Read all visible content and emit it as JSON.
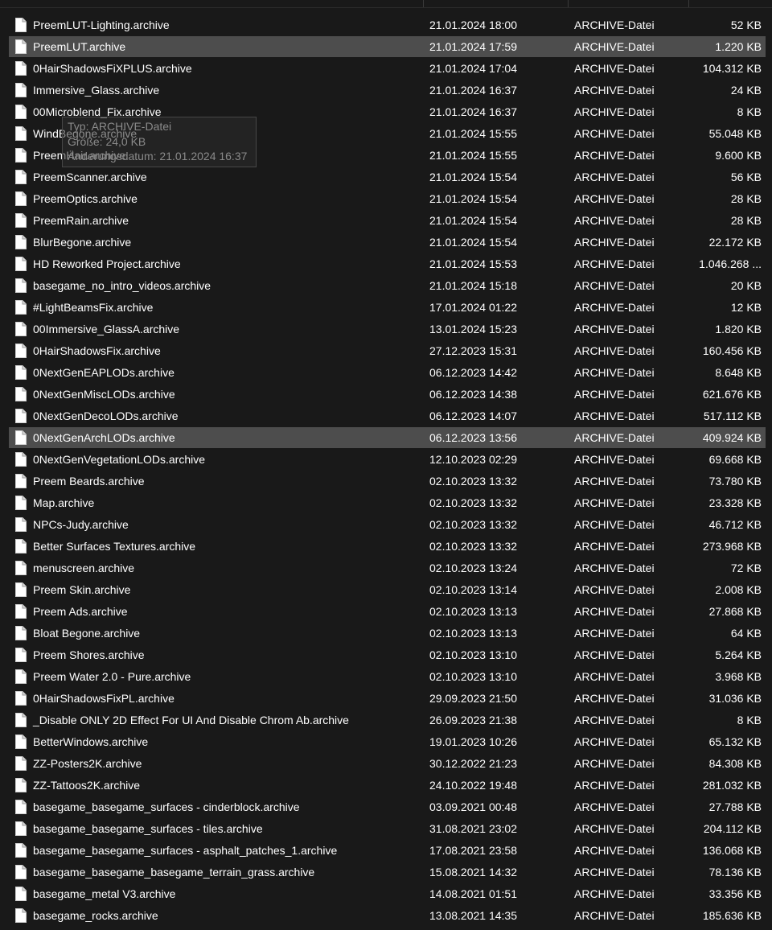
{
  "files": [
    {
      "name": "PreemLUT-Lighting.archive",
      "date": "21.01.2024 18:00",
      "type": "ARCHIVE-Datei",
      "size": "52 KB"
    },
    {
      "name": "PreemLUT.archive",
      "date": "21.01.2024 17:59",
      "type": "ARCHIVE-Datei",
      "size": "1.220 KB",
      "selected": true
    },
    {
      "name": "0HairShadowsFiXPLUS.archive",
      "date": "21.01.2024 17:04",
      "type": "ARCHIVE-Datei",
      "size": "104.312 KB"
    },
    {
      "name": "Immersive_Glass.archive",
      "date": "21.01.2024 16:37",
      "type": "ARCHIVE-Datei",
      "size": "24 KB"
    },
    {
      "name": "00Microblend_Fix.archive",
      "date": "21.01.2024 16:37",
      "type": "ARCHIVE-Datei",
      "size": "8 KB"
    },
    {
      "name": "WindBegone.archive",
      "date": "21.01.2024 15:55",
      "type": "ARCHIVE-Datei",
      "size": "55.048 KB"
    },
    {
      "name": "PreemHair.archive",
      "date": "21.01.2024 15:55",
      "type": "ARCHIVE-Datei",
      "size": "9.600 KB"
    },
    {
      "name": "PreemScanner.archive",
      "date": "21.01.2024 15:54",
      "type": "ARCHIVE-Datei",
      "size": "56 KB"
    },
    {
      "name": "PreemOptics.archive",
      "date": "21.01.2024 15:54",
      "type": "ARCHIVE-Datei",
      "size": "28 KB"
    },
    {
      "name": "PreemRain.archive",
      "date": "21.01.2024 15:54",
      "type": "ARCHIVE-Datei",
      "size": "28 KB"
    },
    {
      "name": "BlurBegone.archive",
      "date": "21.01.2024 15:54",
      "type": "ARCHIVE-Datei",
      "size": "22.172 KB"
    },
    {
      "name": "HD Reworked Project.archive",
      "date": "21.01.2024 15:53",
      "type": "ARCHIVE-Datei",
      "size": "1.046.268 ..."
    },
    {
      "name": "basegame_no_intro_videos.archive",
      "date": "21.01.2024 15:18",
      "type": "ARCHIVE-Datei",
      "size": "20 KB"
    },
    {
      "name": "#LightBeamsFix.archive",
      "date": "17.01.2024 01:22",
      "type": "ARCHIVE-Datei",
      "size": "12 KB"
    },
    {
      "name": "00Immersive_GlassA.archive",
      "date": "13.01.2024 15:23",
      "type": "ARCHIVE-Datei",
      "size": "1.820 KB"
    },
    {
      "name": "0HairShadowsFix.archive",
      "date": "27.12.2023 15:31",
      "type": "ARCHIVE-Datei",
      "size": "160.456 KB"
    },
    {
      "name": "0NextGenEAPLODs.archive",
      "date": "06.12.2023 14:42",
      "type": "ARCHIVE-Datei",
      "size": "8.648 KB"
    },
    {
      "name": "0NextGenMiscLODs.archive",
      "date": "06.12.2023 14:38",
      "type": "ARCHIVE-Datei",
      "size": "621.676 KB"
    },
    {
      "name": "0NextGenDecoLODs.archive",
      "date": "06.12.2023 14:07",
      "type": "ARCHIVE-Datei",
      "size": "517.112 KB"
    },
    {
      "name": "0NextGenArchLODs.archive",
      "date": "06.12.2023 13:56",
      "type": "ARCHIVE-Datei",
      "size": "409.924 KB",
      "selected": true
    },
    {
      "name": "0NextGenVegetationLODs.archive",
      "date": "12.10.2023 02:29",
      "type": "ARCHIVE-Datei",
      "size": "69.668 KB"
    },
    {
      "name": "Preem Beards.archive",
      "date": "02.10.2023 13:32",
      "type": "ARCHIVE-Datei",
      "size": "73.780 KB"
    },
    {
      "name": "Map.archive",
      "date": "02.10.2023 13:32",
      "type": "ARCHIVE-Datei",
      "size": "23.328 KB"
    },
    {
      "name": "NPCs-Judy.archive",
      "date": "02.10.2023 13:32",
      "type": "ARCHIVE-Datei",
      "size": "46.712 KB"
    },
    {
      "name": "Better Surfaces Textures.archive",
      "date": "02.10.2023 13:32",
      "type": "ARCHIVE-Datei",
      "size": "273.968 KB"
    },
    {
      "name": "menuscreen.archive",
      "date": "02.10.2023 13:24",
      "type": "ARCHIVE-Datei",
      "size": "72 KB"
    },
    {
      "name": "Preem Skin.archive",
      "date": "02.10.2023 13:14",
      "type": "ARCHIVE-Datei",
      "size": "2.008 KB"
    },
    {
      "name": "Preem Ads.archive",
      "date": "02.10.2023 13:13",
      "type": "ARCHIVE-Datei",
      "size": "27.868 KB"
    },
    {
      "name": "Bloat Begone.archive",
      "date": "02.10.2023 13:13",
      "type": "ARCHIVE-Datei",
      "size": "64 KB"
    },
    {
      "name": "Preem Shores.archive",
      "date": "02.10.2023 13:10",
      "type": "ARCHIVE-Datei",
      "size": "5.264 KB"
    },
    {
      "name": "Preem Water 2.0 - Pure.archive",
      "date": "02.10.2023 13:10",
      "type": "ARCHIVE-Datei",
      "size": "3.968 KB"
    },
    {
      "name": "0HairShadowsFixPL.archive",
      "date": "29.09.2023 21:50",
      "type": "ARCHIVE-Datei",
      "size": "31.036 KB"
    },
    {
      "name": "_Disable ONLY 2D Effect For UI And Disable Chrom Ab.archive",
      "date": "26.09.2023 21:38",
      "type": "ARCHIVE-Datei",
      "size": "8 KB"
    },
    {
      "name": "BetterWindows.archive",
      "date": "19.01.2023 10:26",
      "type": "ARCHIVE-Datei",
      "size": "65.132 KB"
    },
    {
      "name": "ZZ-Posters2K.archive",
      "date": "30.12.2022 21:23",
      "type": "ARCHIVE-Datei",
      "size": "84.308 KB"
    },
    {
      "name": "ZZ-Tattoos2K.archive",
      "date": "24.10.2022 19:48",
      "type": "ARCHIVE-Datei",
      "size": "281.032 KB"
    },
    {
      "name": "basegame_basegame_surfaces - cinderblock.archive",
      "date": "03.09.2021 00:48",
      "type": "ARCHIVE-Datei",
      "size": "27.788 KB"
    },
    {
      "name": "basegame_basegame_surfaces - tiles.archive",
      "date": "31.08.2021 23:02",
      "type": "ARCHIVE-Datei",
      "size": "204.112 KB"
    },
    {
      "name": "basegame_basegame_surfaces - asphalt_patches_1.archive",
      "date": "17.08.2021 23:58",
      "type": "ARCHIVE-Datei",
      "size": "136.068 KB"
    },
    {
      "name": "basegame_basegame_basegame_terrain_grass.archive",
      "date": "15.08.2021 14:32",
      "type": "ARCHIVE-Datei",
      "size": "78.136 KB"
    },
    {
      "name": "basegame_metal V3.archive",
      "date": "14.08.2021 01:51",
      "type": "ARCHIVE-Datei",
      "size": "33.356 KB"
    },
    {
      "name": "basegame_rocks.archive",
      "date": "13.08.2021 14:35",
      "type": "ARCHIVE-Datei",
      "size": "185.636 KB"
    }
  ],
  "tooltip": {
    "type_line": "Typ: ARCHIVE-Datei",
    "size_line": "Größe: 24,0 KB",
    "date_line": "Änderungsdatum: 21.01.2024 16:37"
  }
}
